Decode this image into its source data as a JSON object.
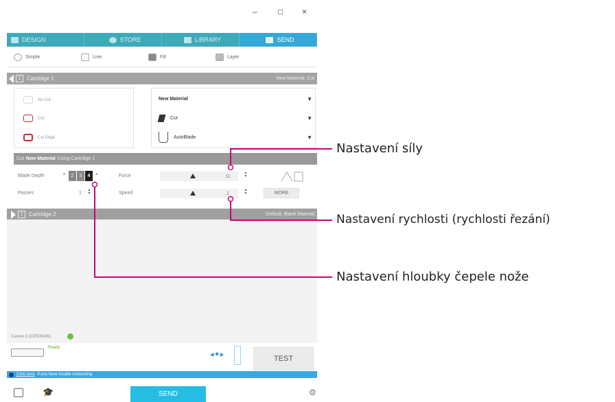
{
  "window": {
    "minimize": "–",
    "maximize": "□",
    "close": "×"
  },
  "tabs": [
    {
      "label": "DESIGN",
      "icon": "design-icon"
    },
    {
      "label": "STORE",
      "icon": "store-icon"
    },
    {
      "label": "LIBRARY",
      "icon": "library-icon"
    },
    {
      "label": "SEND",
      "icon": "send-icon",
      "active": true
    }
  ],
  "subtabs": [
    {
      "label": "Simple"
    },
    {
      "label": "Line"
    },
    {
      "label": "Fill"
    },
    {
      "label": "Layer"
    }
  ],
  "cartridge1": {
    "number": "1",
    "title": "Cartridge 1",
    "right": "New Material, Cut"
  },
  "cut_options": [
    "No Cut",
    "Cut",
    "Cut Edge"
  ],
  "dropdowns": {
    "material": "New Material",
    "action": "Cut",
    "tool": "AutoBlade"
  },
  "status": {
    "prefix": "Cut",
    "material": "New Material",
    "suffix": "Using Cartridge 1"
  },
  "settings": {
    "blade_depth_label": "Blade Depth",
    "blade_depth_cells": [
      "2",
      "3",
      "4"
    ],
    "blade_depth_value": "4",
    "passes_label": "Passes",
    "passes_value": "1",
    "force_label": "Force",
    "force_value": "11",
    "speed_label": "Speed",
    "speed_value": "1",
    "more_label": "MORE"
  },
  "cartridge2": {
    "number": "2",
    "title": "Cartridge 2",
    "right": "Default, Blank Material"
  },
  "device": {
    "name": "Cameo 3 (CP500435)",
    "status": "Ready"
  },
  "test_label": "TEST",
  "info": {
    "link": "Click here",
    "text": "if you have trouble connecting"
  },
  "send_label": "SEND",
  "callouts": {
    "force": "Nastavení síly",
    "speed": "Nastavení rychlosti (rychlosti řezání)",
    "depth": "Nastavení hloubky čepele nože"
  },
  "colors": {
    "tab": "#3ea9b9",
    "tab_active": "#34a9d8",
    "callout_line": "#cc0077",
    "send": "#26bde5",
    "accent_red": "#d6262c"
  }
}
